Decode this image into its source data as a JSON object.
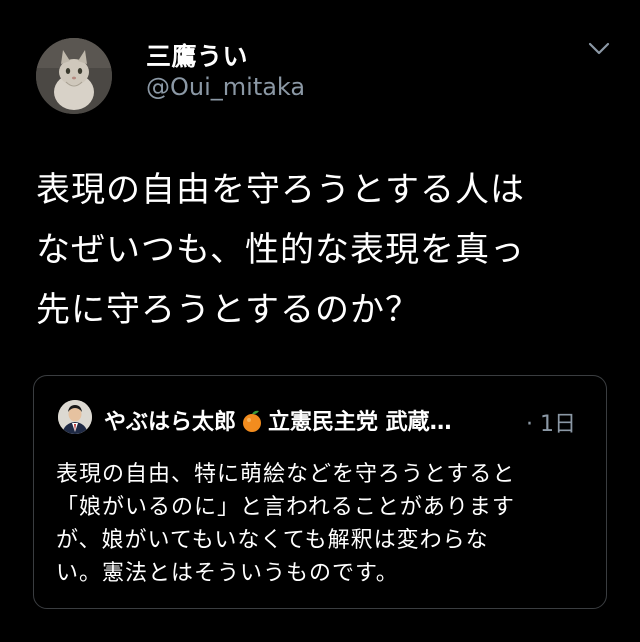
{
  "author": {
    "display_name": "三鷹うい",
    "handle": "@Oui_mitaka"
  },
  "tweet": {
    "lines": [
      "表現の自由を守ろうとする人は",
      "なぜいつも、性的な表現を真っ",
      "先に守ろうとするのか？"
    ]
  },
  "quoted": {
    "name_part1": "やぶはら太郎",
    "name_part2": "立憲民主党 武蔵…",
    "time": "· 1日",
    "emoji_icon": "orange-icon",
    "lines": [
      "表現の自由、特に萌絵などを守ろうとすると",
      "「娘がいるのに」と言われることがあります",
      "が、娘がいてもいなくても解釈は変わらな",
      "い。憲法とはそういうものです。"
    ]
  },
  "colors": {
    "background": "#000000",
    "text": "#ffffff",
    "secondary_text": "#8b98a5",
    "border": "#3a3d40"
  }
}
